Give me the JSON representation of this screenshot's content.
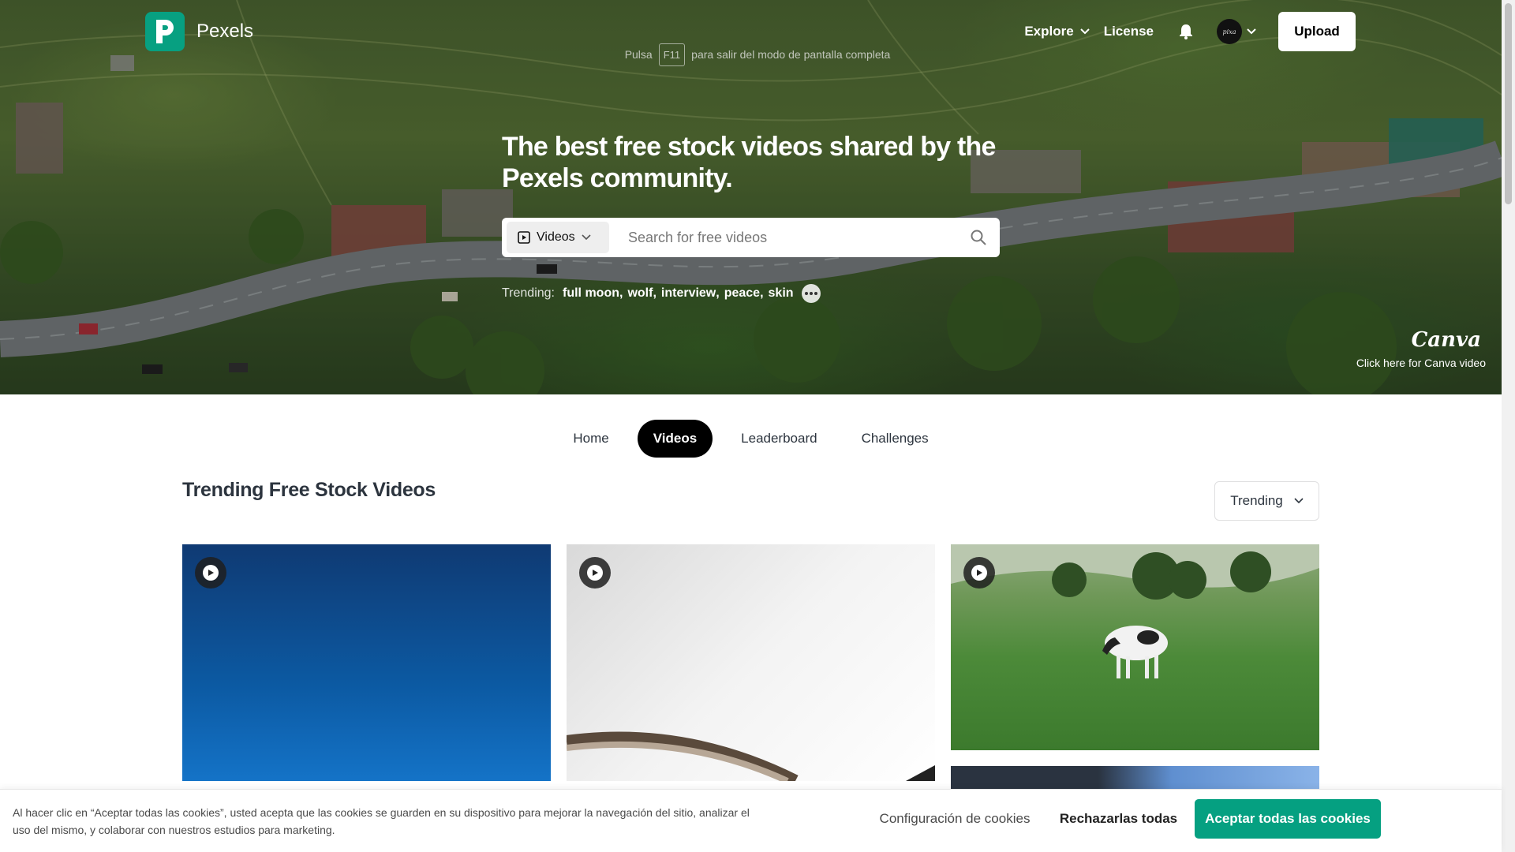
{
  "brand": {
    "name": "Pexels"
  },
  "nav": {
    "explore": "Explore",
    "license": "License",
    "upload": "Upload",
    "avatar_text": "pixa"
  },
  "fullscreen_hint": {
    "before": "Pulsa",
    "key": "F11",
    "after": "para salir del modo de pantalla completa"
  },
  "hero": {
    "headline": "The best free stock videos shared by the Pexels community.",
    "search": {
      "type_label": "Videos",
      "placeholder": "Search for free videos"
    },
    "trending_label": "Trending:",
    "trending_terms": [
      "full moon",
      "wolf",
      "interview",
      "peace",
      "skin"
    ],
    "canva": {
      "mark": "Canva",
      "caption": "Click here for Canva video"
    }
  },
  "tabs": [
    {
      "label": "Home",
      "active": false
    },
    {
      "label": "Videos",
      "active": true
    },
    {
      "label": "Leaderboard",
      "active": false
    },
    {
      "label": "Challenges",
      "active": false
    }
  ],
  "section": {
    "title": "Trending Free Stock Videos",
    "sort_label": "Trending"
  },
  "cookie": {
    "text": "Al hacer clic en “Aceptar todas las cookies”, usted acepta que las cookies se guarden en su dispositivo para mejorar la navegación del sitio, analizar el uso del mismo, y colaborar con nuestros estudios para marketing.",
    "config": "Configuración de cookies",
    "reject": "Rechazarlas todas",
    "accept": "Aceptar todas las cookies"
  },
  "colors": {
    "brand": "#05a081",
    "text": "#2c343e",
    "active_tab": "#000000"
  },
  "icons": [
    "play-icon",
    "search-icon",
    "bell-icon",
    "chevron-down-icon",
    "video-icon",
    "more-icon"
  ]
}
